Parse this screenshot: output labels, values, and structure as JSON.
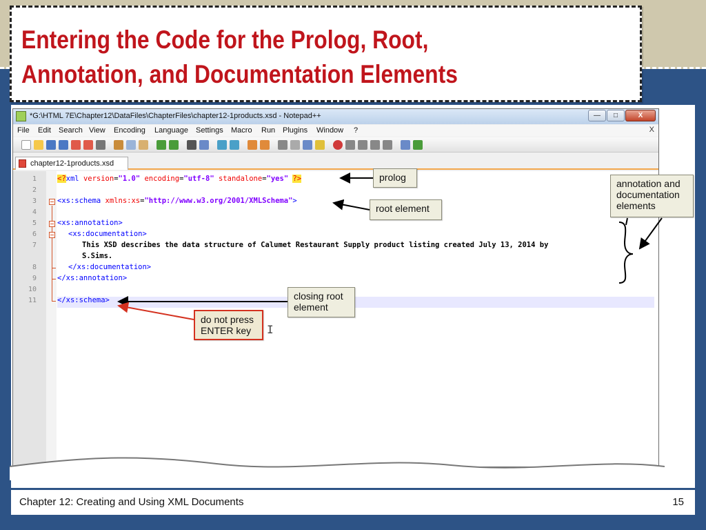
{
  "slide": {
    "title_line1": "Entering the Code for the Prolog, Root,",
    "title_line2": "Annotation, and Documentation Elements",
    "footer_text": "Chapter 12: Creating and Using XML Documents",
    "page_number": "15",
    "colors": {
      "title": "#c0151c",
      "background_top": "#cfc8ad",
      "background_bottom": "#2d5386"
    }
  },
  "window": {
    "title": "*G:\\HTML 7E\\Chapter12\\DataFiles\\ChapterFiles\\chapter12-1products.xsd - Notepad++",
    "minimize_label": "—",
    "maximize_label": "□",
    "close_label": "X",
    "menu": [
      "File",
      "Edit",
      "Search",
      "View",
      "Encoding",
      "Language",
      "Settings",
      "Macro",
      "Run",
      "Plugins",
      "Window",
      "?"
    ],
    "menu_close": "X",
    "tab_label": "chapter12-1products.xsd"
  },
  "editor": {
    "line_numbers": [
      "1",
      "2",
      "3",
      "4",
      "5",
      "6",
      "7",
      "8",
      "9",
      "10",
      "11"
    ],
    "line1": {
      "pi_open": "<?",
      "name": "xml",
      "attr1": "version",
      "val1": "\"1.0\"",
      "attr2": "encoding",
      "val2": "\"utf-8\"",
      "attr3": "standalone",
      "val3": "\"yes\"",
      "pi_close": "?>"
    },
    "line3": {
      "open": "<xs:schema",
      "attr": "xmlns:xs",
      "val": "\"http://www.w3.org/2001/XMLSchema\"",
      "close": ">"
    },
    "line5": "<xs:annotation>",
    "line6": "<xs:documentation>",
    "line7a": "This XSD describes the data structure of Calumet Restaurant Supply product listing created July 13, 2014 by",
    "line7b": "S.Sims.",
    "line8": "</xs:documentation>",
    "line9": "</xs:annotation>",
    "line11": "</xs:schema>"
  },
  "callouts": {
    "prolog": "prolog",
    "root_element": "root element",
    "annotation_l1": "annotation and",
    "annotation_l2": "documentation",
    "annotation_l3": "elements",
    "closing_l1": "closing root",
    "closing_l2": "element",
    "donot_l1": "do not press",
    "donot_l2": "ENTER key"
  }
}
